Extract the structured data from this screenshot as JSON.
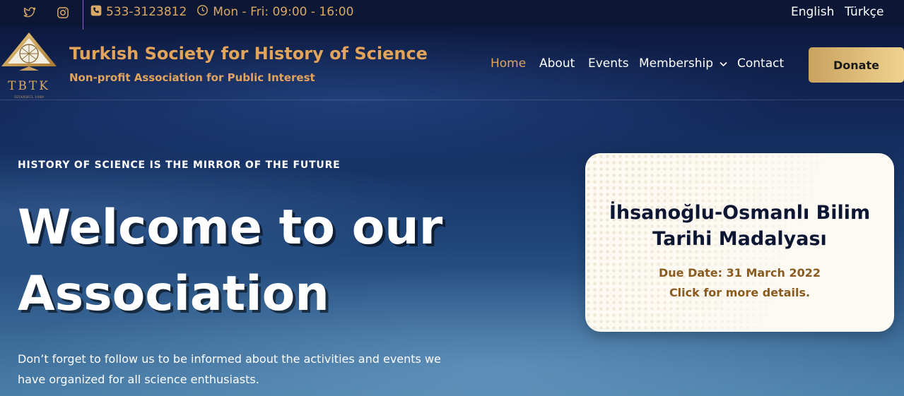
{
  "topbar": {
    "twitter_icon": "twitter-icon",
    "instagram_icon": "instagram-icon",
    "phone": "533-3123812",
    "hours": "Mon - Fri: 09:00 - 16:00",
    "languages": [
      "English",
      "Türkçe"
    ]
  },
  "brand": {
    "logo_text": "TBTK",
    "logo_subtext": "İSTANBUL 1989",
    "title": "Turkish Society for History of Science",
    "subtitle": "Non-profit Association for Public Interest"
  },
  "nav": {
    "items": [
      "Home",
      "About",
      "Events",
      "Membership",
      "Contact"
    ],
    "active": "Home",
    "donate_label": "Donate"
  },
  "hero": {
    "kicker": "HISTORY OF SCIENCE IS THE MIRROR OF THE FUTURE",
    "title": "Welcome to our Association",
    "text": "Don’t forget to follow us to be informed about the activities and events we have organized for all science enthusiasts."
  },
  "card": {
    "title": "İhsanoğlu-Osmanlı Bilim Tarihi Madalyası",
    "due_date": "Due Date: 31 March 2022",
    "more": "Click for more details."
  },
  "colors": {
    "accent": "#e2a35a",
    "navy": "#0c1736",
    "card_text": "#8a5a1e"
  }
}
